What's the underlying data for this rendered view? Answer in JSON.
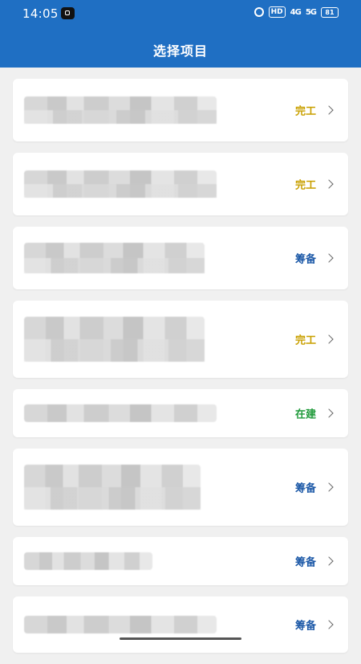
{
  "status_bar": {
    "time": "14:05",
    "hd_label": "HD",
    "signal1": "4G",
    "signal2": "5G",
    "battery": "81"
  },
  "header": {
    "title": "选择项目"
  },
  "colors": {
    "header_bg": "#1f6fc3",
    "status_complete": "#c9a000",
    "status_preparing": "#1e5aa8",
    "status_building": "#1f9a3a"
  },
  "projects": [
    {
      "name": "",
      "status": "完工",
      "status_color": "#c9a000"
    },
    {
      "name": "",
      "status": "完工",
      "status_color": "#c9a000"
    },
    {
      "name": "",
      "status": "筹备",
      "status_color": "#1e5aa8"
    },
    {
      "name": "",
      "status": "完工",
      "status_color": "#c9a000"
    },
    {
      "name": "",
      "status": "在建",
      "status_color": "#1f9a3a"
    },
    {
      "name": "",
      "status": "筹备",
      "status_color": "#1e5aa8"
    },
    {
      "name": "",
      "status": "筹备",
      "status_color": "#1e5aa8"
    },
    {
      "name": "",
      "status": "筹备",
      "status_color": "#1e5aa8"
    }
  ]
}
